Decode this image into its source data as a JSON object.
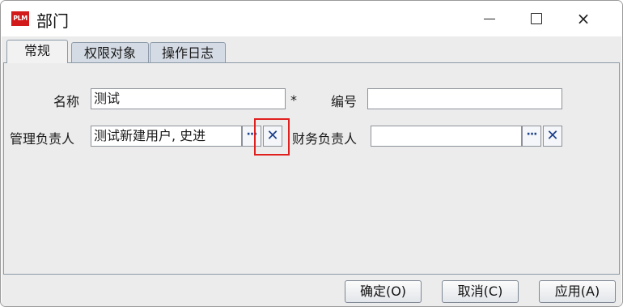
{
  "window": {
    "app_icon_text": "PLM",
    "title": "部门",
    "controls": {
      "minimize": "minimize-icon",
      "maximize": "maximize-icon",
      "close": "×"
    }
  },
  "tabs": [
    {
      "label": "常规",
      "active": true
    },
    {
      "label": "权限对象",
      "active": false
    },
    {
      "label": "操作日志",
      "active": false
    }
  ],
  "form": {
    "name": {
      "label": "名称",
      "value": "测试",
      "required_mark": "*"
    },
    "code": {
      "label": "编号",
      "value": ""
    },
    "manager": {
      "label": "管理负责人",
      "value": "测试新建用户, 史进",
      "browse": "···",
      "clear": "✕"
    },
    "finance": {
      "label": "财务负责人",
      "value": "",
      "browse": "···",
      "clear": "✕"
    }
  },
  "buttons": {
    "ok": "确定(O)",
    "cancel": "取消(C)",
    "apply": "应用(A)"
  },
  "colors": {
    "highlight": "#e0201f",
    "app_icon": "#d21a1a",
    "button_glyph": "#1b3f8a"
  }
}
